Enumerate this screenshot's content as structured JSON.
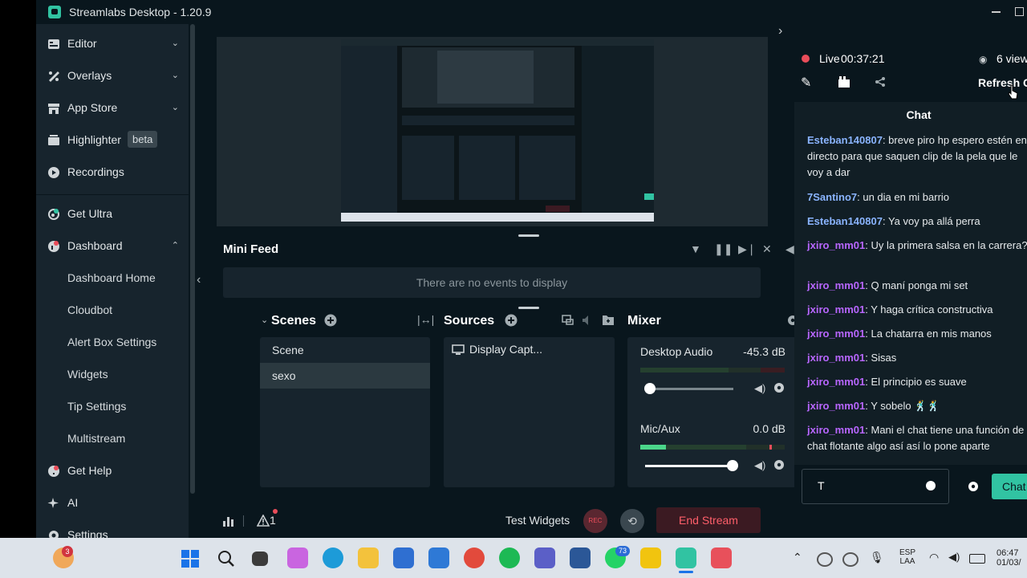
{
  "window": {
    "title": "Streamlabs Desktop - 1.20.9"
  },
  "sidebar": {
    "items": [
      {
        "label": "Editor",
        "icon": "editor-icon",
        "chevron": "⌄"
      },
      {
        "label": "Overlays",
        "icon": "overlays-icon",
        "chevron": "⌄"
      },
      {
        "label": "App Store",
        "icon": "app-store-icon",
        "chevron": "⌄"
      },
      {
        "label": "Highlighter",
        "icon": "highlighter-icon",
        "badge": "beta"
      },
      {
        "label": "Recordings",
        "icon": "recordings-icon"
      },
      {
        "label": "Get Ultra",
        "icon": "ultra-icon"
      },
      {
        "label": "Dashboard",
        "icon": "dashboard-icon",
        "chevron": "⌃"
      },
      {
        "label": "Dashboard Home"
      },
      {
        "label": "Cloudbot"
      },
      {
        "label": "Alert Box Settings"
      },
      {
        "label": "Widgets"
      },
      {
        "label": "Tip Settings"
      },
      {
        "label": "Multistream"
      },
      {
        "label": "Get Help",
        "icon": "help-icon"
      },
      {
        "label": "AI",
        "icon": "ai-icon"
      },
      {
        "label": "Settings",
        "icon": "settings-icon"
      }
    ]
  },
  "minifeed": {
    "title": "Mini Feed",
    "empty": "There are no events to display"
  },
  "scenes": {
    "title": "Scenes",
    "items": [
      "Scene",
      "sexo"
    ],
    "selected": "sexo"
  },
  "sources": {
    "title": "Sources",
    "items": [
      "Display Capt..."
    ]
  },
  "mixer": {
    "title": "Mixer",
    "channels": [
      {
        "name": "Desktop Audio",
        "db": "-45.3 dB",
        "volume": 0.05
      },
      {
        "name": "Mic/Aux",
        "db": "0.0 dB",
        "volume": 0.99
      }
    ]
  },
  "bottom": {
    "alert_count": "1",
    "test_widgets": "Test Widgets",
    "rec": "REC",
    "end_stream": "End Stream"
  },
  "live": {
    "status": "Live",
    "time": "00:37:21",
    "viewers": "6 view",
    "refresh": "Refresh C"
  },
  "chat": {
    "title": "Chat",
    "messages": [
      {
        "user": "Esteban140807",
        "color": "#8ab4ff",
        "text": ": breve piro hp espero estén en directo para que saquen clip de la pela que le voy a dar"
      },
      {
        "user": "7Santino7",
        "color": "#8ab4ff",
        "text": ": un dia en mi barrio"
      },
      {
        "user": "Esteban140807",
        "color": "#8ab4ff",
        "text": ": Ya voy pa allá perra"
      },
      {
        "user": "jxiro_mm01",
        "color": "#b866ff",
        "text": ": Uy la primera salsa en la carrera?"
      },
      {
        "user": "jxiro_mm01",
        "color": "#b866ff",
        "text": ": Q maní ponga mi set"
      },
      {
        "user": "jxiro_mm01",
        "color": "#b866ff",
        "text": ": Y haga crítica constructiva"
      },
      {
        "user": "jxiro_mm01",
        "color": "#b866ff",
        "text": ": La chatarra en mis manos"
      },
      {
        "user": "jxiro_mm01",
        "color": "#b866ff",
        "text": ": Sisas"
      },
      {
        "user": "jxiro_mm01",
        "color": "#b866ff",
        "text": ": El principio es suave"
      },
      {
        "user": "jxiro_mm01",
        "color": "#b866ff",
        "text": ": Y sobelo 🕺🕺"
      },
      {
        "user": "jxiro_mm01",
        "color": "#b866ff",
        "text": ": Mani el chat tiene una función de chat flotante algo así así lo pone aparte"
      }
    ],
    "input_value": "T",
    "send_label": "Chat"
  },
  "taskbar": {
    "notif_badge": "3",
    "whatsapp_badge": "73",
    "lang1": "ESP",
    "lang2": "LAA",
    "time": "06:47",
    "date": "01/03/"
  }
}
